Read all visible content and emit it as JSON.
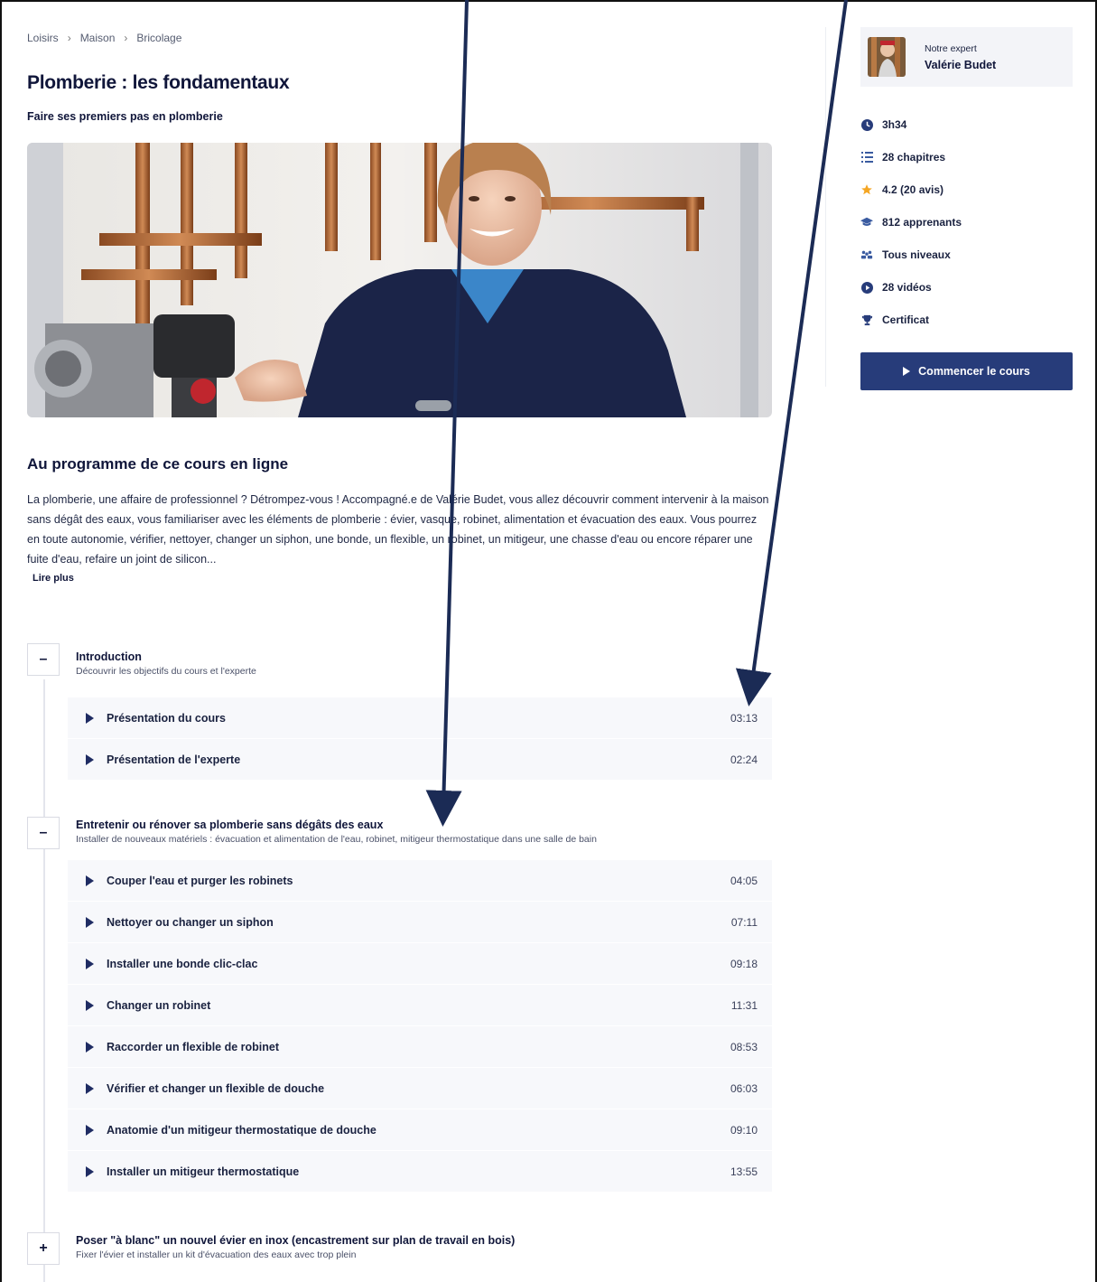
{
  "breadcrumb": {
    "items": [
      "Loisirs",
      "Maison",
      "Bricolage"
    ]
  },
  "course": {
    "title": "Plomberie : les fondamentaux",
    "subtitle": "Faire ses premiers pas en plomberie"
  },
  "program": {
    "heading": "Au programme de ce cours en ligne",
    "description": "La plomberie, une affaire de professionnel ? Détrompez-vous ! Accompagné.e de Valérie Budet, vous allez découvrir comment intervenir à la maison sans dégât des eaux, vous familiariser avec les éléments de plomberie : évier, vasque, robinet, alimentation et évacuation des eaux. Vous pourrez en toute autonomie, vérifier, nettoyer, changer un siphon, une bonde, un flexible, un robinet, un mitigeur, une chasse d'eau ou encore réparer une fuite d'eau, refaire un joint de silicon...",
    "read_more": "Lire plus"
  },
  "chapters": [
    {
      "toggle": "–",
      "title": "Introduction",
      "subtitle": "Découvrir les objectifs du cours et l'experte",
      "lessons": [
        {
          "title": "Présentation du cours",
          "time": "03:13"
        },
        {
          "title": "Présentation de l'experte",
          "time": "02:24"
        }
      ]
    },
    {
      "toggle": "–",
      "title": "Entretenir ou rénover sa plomberie sans dégâts des eaux",
      "subtitle": "Installer de nouveaux matériels : évacuation et alimentation de l'eau, robinet, mitigeur thermostatique dans une salle de bain",
      "lessons": [
        {
          "title": "Couper l'eau et purger les robinets",
          "time": "04:05"
        },
        {
          "title": "Nettoyer ou changer un siphon",
          "time": "07:11"
        },
        {
          "title": "Installer une bonde clic-clac",
          "time": "09:18"
        },
        {
          "title": "Changer un robinet",
          "time": "11:31"
        },
        {
          "title": "Raccorder un flexible de robinet",
          "time": "08:53"
        },
        {
          "title": "Vérifier et changer un flexible de douche",
          "time": "06:03"
        },
        {
          "title": "Anatomie d'un mitigeur thermostatique de douche",
          "time": "09:10"
        },
        {
          "title": "Installer un mitigeur thermostatique",
          "time": "13:55"
        }
      ]
    },
    {
      "toggle": "+",
      "title": "Poser \"à blanc\" un nouvel évier en inox (encastrement sur plan de travail en bois)",
      "subtitle": "Fixer l'évier et installer un kit d'évacuation des eaux avec trop plein",
      "lessons": []
    }
  ],
  "sidebar": {
    "expert_label": "Notre expert",
    "expert_name": "Valérie Budet",
    "stats": [
      {
        "icon": "clock-icon",
        "label": "3h34"
      },
      {
        "icon": "list-icon",
        "label": "28 chapitres"
      },
      {
        "icon": "star-icon",
        "label": "4.2 (20 avis)"
      },
      {
        "icon": "graduation-cap-icon",
        "label": "812 apprenants"
      },
      {
        "icon": "users-icon",
        "label": "Tous niveaux"
      },
      {
        "icon": "play-circle-icon",
        "label": "28 vidéos"
      },
      {
        "icon": "trophy-icon",
        "label": "Certificat"
      }
    ],
    "cta_label": "Commencer le cours"
  },
  "colors": {
    "primary": "#273c7a",
    "text": "#10163a",
    "star": "#f5a623",
    "lesson_bg": "#f7f8fb"
  }
}
